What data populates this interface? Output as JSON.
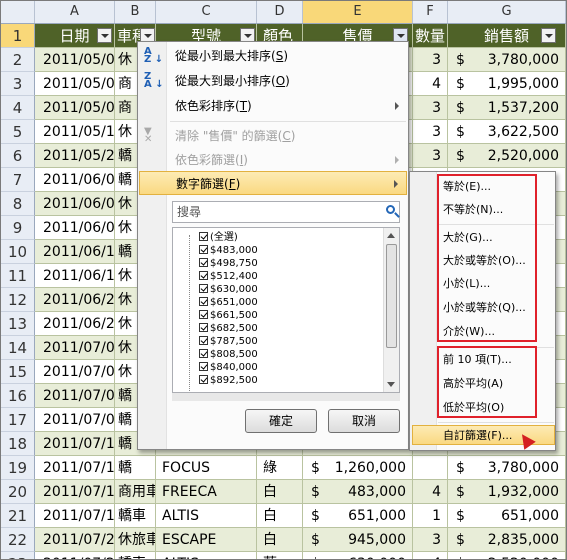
{
  "columns": [
    "A",
    "B",
    "C",
    "D",
    "E",
    "F",
    "G"
  ],
  "row_numbers": [
    "1",
    "2",
    "3",
    "4",
    "5",
    "6",
    "7",
    "8",
    "9",
    "10",
    "11",
    "12",
    "13",
    "14",
    "15",
    "16",
    "17",
    "18",
    "19",
    "20",
    "21",
    "22",
    "23"
  ],
  "header_row": {
    "date": "日期",
    "car_type": "車種",
    "model": "型號",
    "color": "顏色",
    "price": "售價",
    "qty": "數量",
    "sales": "銷售額"
  },
  "rows": [
    {
      "date": "2011/05/02",
      "type": "休",
      "qty": "3",
      "sales": "3,780,000"
    },
    {
      "date": "2011/05/02",
      "type": "商",
      "qty": "4",
      "sales": "1,995,000"
    },
    {
      "date": "2011/05/09",
      "type": "商",
      "qty": "3",
      "sales": "1,537,200"
    },
    {
      "date": "2011/05/17",
      "type": "休",
      "qty": "3",
      "sales": "3,622,500"
    },
    {
      "date": "2011/05/25",
      "type": "轎",
      "qty": "3",
      "sales": "2,520,000"
    },
    {
      "date": "2011/06/03",
      "type": "轎",
      "qty": "",
      "sales": ""
    },
    {
      "date": "2011/06/07",
      "type": "休",
      "qty": "",
      "sales": ""
    },
    {
      "date": "2011/06/07",
      "type": "休",
      "qty": "",
      "sales": ""
    },
    {
      "date": "2011/06/14",
      "type": "轎",
      "qty": "",
      "sales": ""
    },
    {
      "date": "2011/06/19",
      "type": "休",
      "qty": "",
      "sales": ""
    },
    {
      "date": "2011/06/23",
      "type": "休",
      "qty": "",
      "sales": ""
    },
    {
      "date": "2011/06/23",
      "type": "休",
      "qty": "",
      "sales": ""
    },
    {
      "date": "2011/07/01",
      "type": "休",
      "qty": "",
      "sales": ""
    },
    {
      "date": "2011/07/02",
      "type": "休",
      "qty": "",
      "sales": ""
    },
    {
      "date": "2011/07/02",
      "type": "轎",
      "qty": "",
      "sales": ""
    },
    {
      "date": "2011/07/06",
      "type": "轎",
      "qty": "",
      "sales": ""
    },
    {
      "date": "2011/07/11",
      "type": "轎",
      "qty": "",
      "sales": ""
    },
    {
      "date": "2011/07/11",
      "type": "轎",
      "model": "FOCUS",
      "color": "綠",
      "price": "1,260,000",
      "qty": "",
      "sales": "3,780,000"
    },
    {
      "date": "2011/07/13",
      "type": "商用車",
      "model": "FREECA",
      "color": "白",
      "price": "483,000",
      "qty": "4",
      "sales": "1,932,000"
    },
    {
      "date": "2011/07/17",
      "type": "轎車",
      "model": "ALTIS",
      "color": "白",
      "price": "651,000",
      "qty": "1",
      "sales": "651,000"
    },
    {
      "date": "2011/07/20",
      "type": "休旅車",
      "model": "ESCAPE",
      "color": "白",
      "price": "945,000",
      "qty": "3",
      "sales": "2,835,000"
    },
    {
      "date": "2011/07/21",
      "type": "轎車",
      "model": "ALTIS",
      "color": "藍",
      "price": "630,000",
      "qty": "4",
      "sales": "2,520,000"
    }
  ],
  "currency": "$",
  "menu": {
    "sort_asc": "從最小到最大排序(",
    "sort_asc_key": "S",
    "sort_desc": "從最大到最小排序(",
    "sort_desc_key": "O",
    "sort_color": "依色彩排序(",
    "sort_color_key": "T",
    "clear_filter": "清除 \"售價\" 的篩選(",
    "clear_filter_key": "C",
    "filter_color": "依色彩篩選(",
    "filter_color_key": "I",
    "number_filter": "數字篩選(",
    "number_filter_key": "F",
    "search_placeholder": "搜尋",
    "list": [
      "(全選)",
      "$483,000",
      "$498,750",
      "$512,400",
      "$630,000",
      "$651,000",
      "$661,500",
      "$682,500",
      "$787,500",
      "$808,500",
      "$840,000",
      "$892,500"
    ],
    "ok": "確定",
    "cancel": "取消"
  },
  "submenu": {
    "equals": "等於(E)...",
    "not_equal": "不等於(N)...",
    "greater": "大於(G)...",
    "greater_eq": "大於或等於(O)...",
    "less": "小於(L)...",
    "less_eq": "小於或等於(Q)...",
    "between": "介於(W)...",
    "top10": "前 10 項(T)...",
    "above_avg": "高於平均(A)",
    "below_avg": "低於平均(O)",
    "custom": "自訂篩選(F)..."
  },
  "colors": {
    "header_bg": "#4f6228",
    "band": "#e8edd8",
    "highlight": "#fad982",
    "red_box": "#e0212b"
  }
}
